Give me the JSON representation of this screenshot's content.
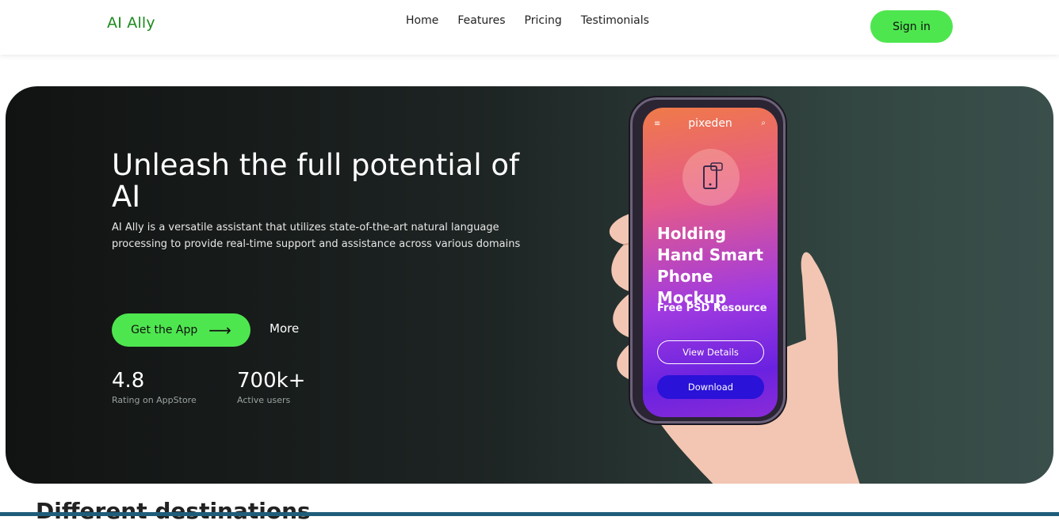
{
  "header": {
    "logo": "AI Ally",
    "nav": [
      "Home",
      "Features",
      "Pricing",
      "Testimonials"
    ],
    "signin_label": "Sign in"
  },
  "hero": {
    "title": "Unleash the full potential of AI",
    "description": "AI Ally is a versatile assistant that utilizes state-of-the-art natural language processing to provide real-time support and assistance across various domains",
    "cta_label": "Get the App",
    "cta_icon": "arrow-right-icon",
    "more_label": "More",
    "stats": [
      {
        "value": "4.8",
        "label": "Rating on AppStore"
      },
      {
        "value": "700k+",
        "label": "Active users"
      }
    ]
  },
  "mockup": {
    "brand": "pixeden",
    "title": "Holding Hand Smart Phone Mockup",
    "subtitle": "Free PSD Resource",
    "view_label": "View Details",
    "download_label": "Download"
  },
  "next_section": {
    "title": "Different destinations"
  },
  "colors": {
    "accent": "#4ee64f",
    "logo": "#1e8a1e",
    "hero_dark": "#111312",
    "hero_teal": "#3a4f4b"
  }
}
